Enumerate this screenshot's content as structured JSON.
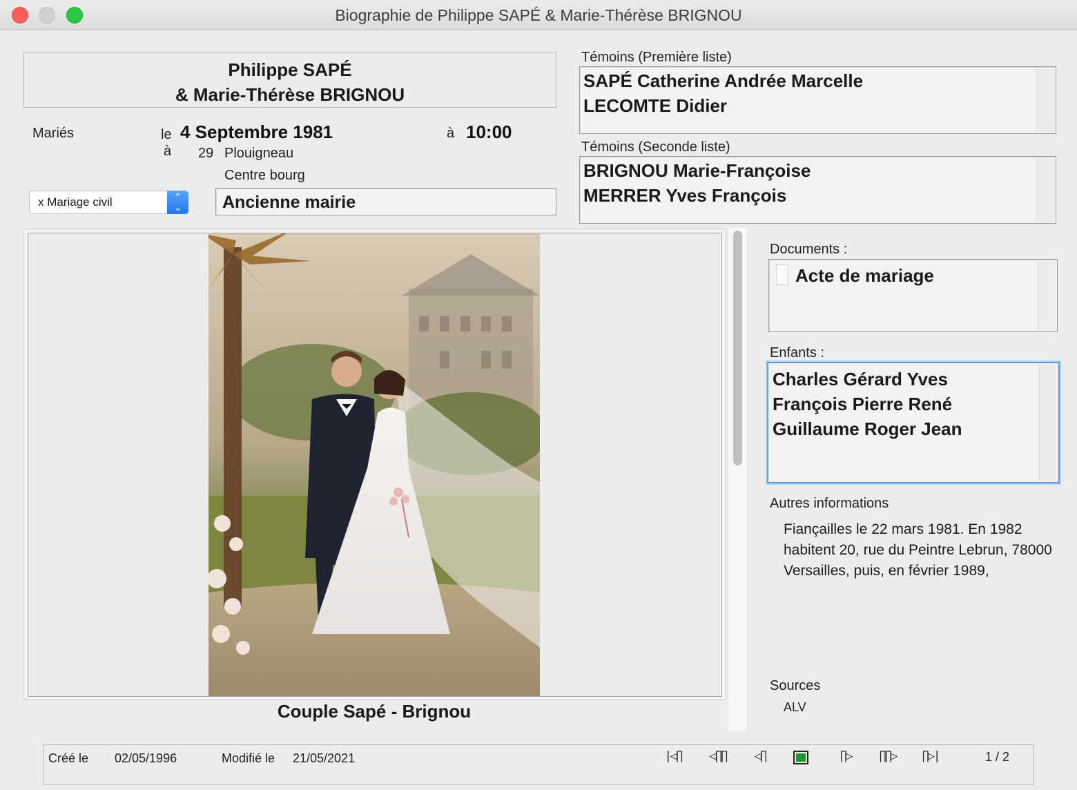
{
  "window": {
    "title": "Biographie de Philippe SAPÉ &  Marie-Thérèse BRIGNOU"
  },
  "couple": {
    "line1": "Philippe SAPÉ",
    "line2": "&  Marie-Thérèse BRIGNOU"
  },
  "event": {
    "label": "Mariés",
    "le_label": "le",
    "date": "4 Septembre 1981",
    "a_label_time": "à",
    "time": "10:00",
    "a_label_place": "à",
    "dept": "29",
    "town": "Plouigneau",
    "locality": "Centre bourg",
    "place_detail": "Ancienne mairie",
    "type_selected": "x Mariage civil"
  },
  "witnesses1": {
    "label": "Témoins (Première liste)",
    "items": [
      "SAPÉ Catherine Andrée Marcelle",
      "LECOMTE Didier"
    ]
  },
  "witnesses2": {
    "label": "Témoins (Seconde liste)",
    "items": [
      "BRIGNOU Marie-Françoise",
      "MERRER Yves François"
    ]
  },
  "documents": {
    "label": "Documents :",
    "items": [
      "Acte de mariage"
    ]
  },
  "children": {
    "label": "Enfants :",
    "items": [
      "Charles Gérard Yves",
      "François Pierre René",
      "Guillaume Roger Jean"
    ]
  },
  "other_info": {
    "label": "Autres informations",
    "text": "Fiançailles le 22 mars 1981. En 1982 habitent 20, rue du Peintre Lebrun, 78000 Versailles, puis, en février 1989,"
  },
  "sources": {
    "label": "Sources",
    "text": "ALV"
  },
  "photo": {
    "caption": "Couple Sapé - Brignou"
  },
  "footer": {
    "created_label": "Créé le",
    "created": "02/05/1996",
    "modified_label": "Modifié le",
    "modified": "21/05/2021",
    "nav": [
      "|◁∏",
      "◁∏∏",
      "◁∏",
      "▣",
      "∏▷",
      "∏∏▷",
      "∏▷|"
    ],
    "page": "1 / 2"
  },
  "colors": {
    "focus_ring": "#5a9be8",
    "popup_arrow": "#1f77ee",
    "record_indicator": "#1a9b2a"
  }
}
